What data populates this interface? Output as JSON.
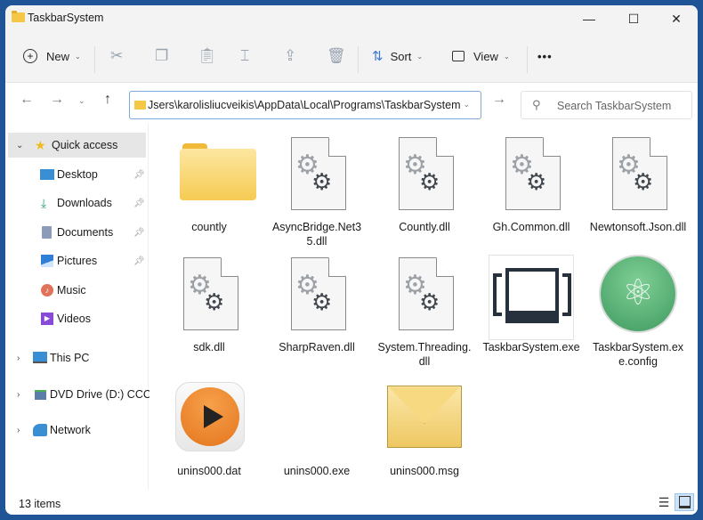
{
  "window": {
    "title": "TaskbarSystem",
    "controls": {
      "minimize": "—",
      "maximize": "☐",
      "close": "✕"
    }
  },
  "toolbar": {
    "new_label": "New",
    "sort_label": "Sort",
    "view_label": "View",
    "more_label": "•••"
  },
  "navigation": {
    "address": "Jsers\\karolisliucveikis\\AppData\\Local\\Programs\\TaskbarSystem",
    "search_placeholder": "Search TaskbarSystem"
  },
  "sidebar": {
    "quick_access": "Quick access",
    "items": [
      {
        "label": "Desktop",
        "icon": "desktop-icon",
        "pinned": true
      },
      {
        "label": "Downloads",
        "icon": "download-icon",
        "pinned": true
      },
      {
        "label": "Documents",
        "icon": "documents-icon",
        "pinned": true
      },
      {
        "label": "Pictures",
        "icon": "pictures-icon",
        "pinned": true
      },
      {
        "label": "Music",
        "icon": "music-icon",
        "pinned": false
      },
      {
        "label": "Videos",
        "icon": "videos-icon",
        "pinned": false
      }
    ],
    "roots": [
      {
        "label": "This PC",
        "icon": "pc-icon"
      },
      {
        "label": "DVD Drive (D:) CCCC",
        "icon": "dvd-drive-icon"
      },
      {
        "label": "Network",
        "icon": "network-icon"
      }
    ]
  },
  "files": [
    {
      "name": "countly",
      "type": "folder"
    },
    {
      "name": "AsyncBridge.Net35.dll",
      "type": "dll"
    },
    {
      "name": "Countly.dll",
      "type": "dll"
    },
    {
      "name": "Gh.Common.dll",
      "type": "dll"
    },
    {
      "name": "Newtonsoft.Json.dll",
      "type": "dll"
    },
    {
      "name": "sdk.dll",
      "type": "dll"
    },
    {
      "name": "SharpRaven.dll",
      "type": "dll"
    },
    {
      "name": "System.Threading.dll",
      "type": "dll"
    },
    {
      "name": "TaskbarSystem.exe",
      "type": "exe"
    },
    {
      "name": "TaskbarSystem.exe.config",
      "type": "config"
    },
    {
      "name": "unins000.dat",
      "type": "dat"
    },
    {
      "name": "unins000.exe",
      "type": "exe-blank"
    },
    {
      "name": "unins000.msg",
      "type": "msg"
    }
  ],
  "status": {
    "item_count": "13 items"
  }
}
